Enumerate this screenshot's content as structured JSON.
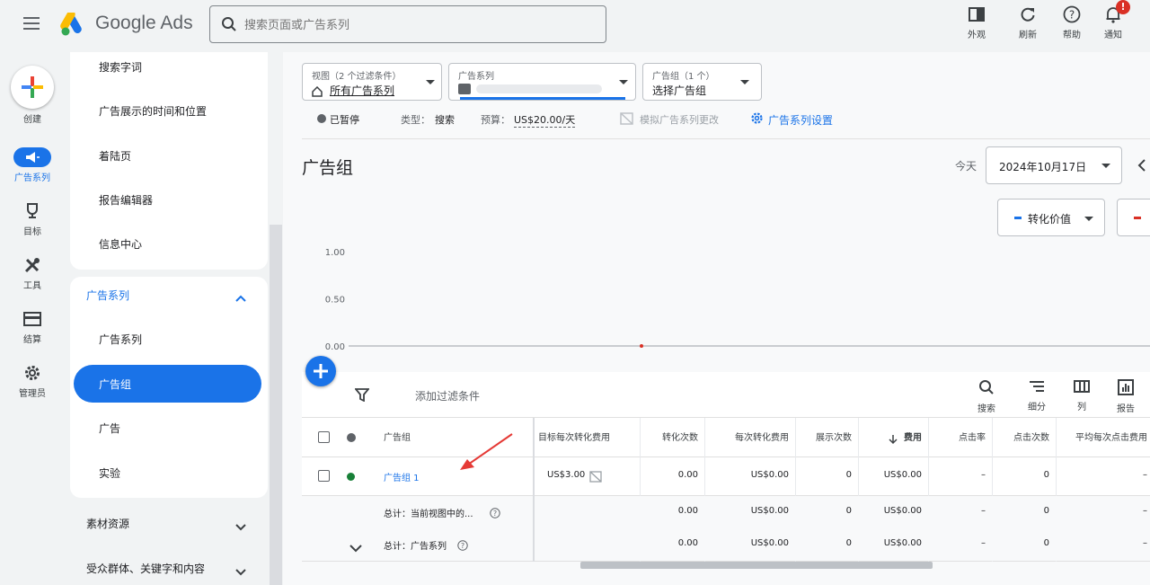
{
  "app": {
    "name": "Google Ads"
  },
  "search": {
    "placeholder": "搜索页面或广告系列"
  },
  "toolbar": {
    "appearance": "外观",
    "refresh": "刷新",
    "help": "帮助",
    "notifications": "通知",
    "notification_badge": "!"
  },
  "rail": {
    "create": "创建",
    "campaigns": "广告系列",
    "goals": "目标",
    "tools": "工具",
    "billing": "结算",
    "admin": "管理员"
  },
  "nav": {
    "top_items": [
      "搜索字词",
      "广告展示的时间和位置",
      "着陆页",
      "报告编辑器",
      "信息中心"
    ],
    "campaigns_section": "广告系列",
    "campaigns_items": [
      "广告系列",
      "广告组",
      "广告",
      "实验"
    ],
    "collapsed": [
      "素材资源",
      "受众群体、关键字和内容"
    ]
  },
  "filters": {
    "view_label": "视图（2 个过滤条件）",
    "view_value": "所有广告系列",
    "campaign_label": "广告系列",
    "adgroup_label": "广告组（1 个）",
    "adgroup_value": "选择广告组"
  },
  "status": {
    "paused": "已暂停",
    "type_label": "类型：",
    "type_value": "搜索",
    "budget_label": "预算：",
    "budget_value": "US$20.00/天",
    "simulate": "模拟广告系列更改",
    "settings": "广告系列设置"
  },
  "page": {
    "title": "广告组",
    "today": "今天",
    "date": "2024年10月17日"
  },
  "metrics": {
    "metric1": "转化价值",
    "metric1_color": "#1a73e8",
    "metric2_color": "#d93025"
  },
  "chart_data": {
    "type": "line",
    "y_ticks": [
      "1.00",
      "0.50",
      "0.00"
    ],
    "ylim": [
      0,
      1
    ],
    "series": [
      {
        "values": [
          0
        ]
      }
    ]
  },
  "table": {
    "add_filter": "添加过滤条件",
    "tools": {
      "search": "搜索",
      "segment": "细分",
      "columns": "列",
      "report": "报告"
    },
    "headers": {
      "adgroup": "广告组",
      "target_cpa": "目标每次转化费用",
      "conversions": "转化次数",
      "cost_per_conv": "每次转化费用",
      "impressions": "展示次数",
      "cost": "费用",
      "ctr": "点击率",
      "clicks": "点击次数",
      "avg_cpc": "平均每次点击费用"
    },
    "rows": [
      {
        "name": "广告组 1",
        "target_cpa": "US$3.00",
        "conversions": "0.00",
        "cost_per_conv": "US$0.00",
        "impressions": "0",
        "cost": "US$0.00",
        "ctr": "–",
        "clicks": "0",
        "avg_cpc": "–"
      }
    ],
    "totals": [
      {
        "label": "总计：当前视图中的...",
        "conversions": "0.00",
        "cost_per_conv": "US$0.00",
        "impressions": "0",
        "cost": "US$0.00",
        "ctr": "–",
        "clicks": "0",
        "avg_cpc": "–"
      },
      {
        "label": "总计：广告系列",
        "conversions": "0.00",
        "cost_per_conv": "US$0.00",
        "impressions": "0",
        "cost": "US$0.00",
        "ctr": "–",
        "clicks": "0",
        "avg_cpc": "–"
      }
    ]
  }
}
